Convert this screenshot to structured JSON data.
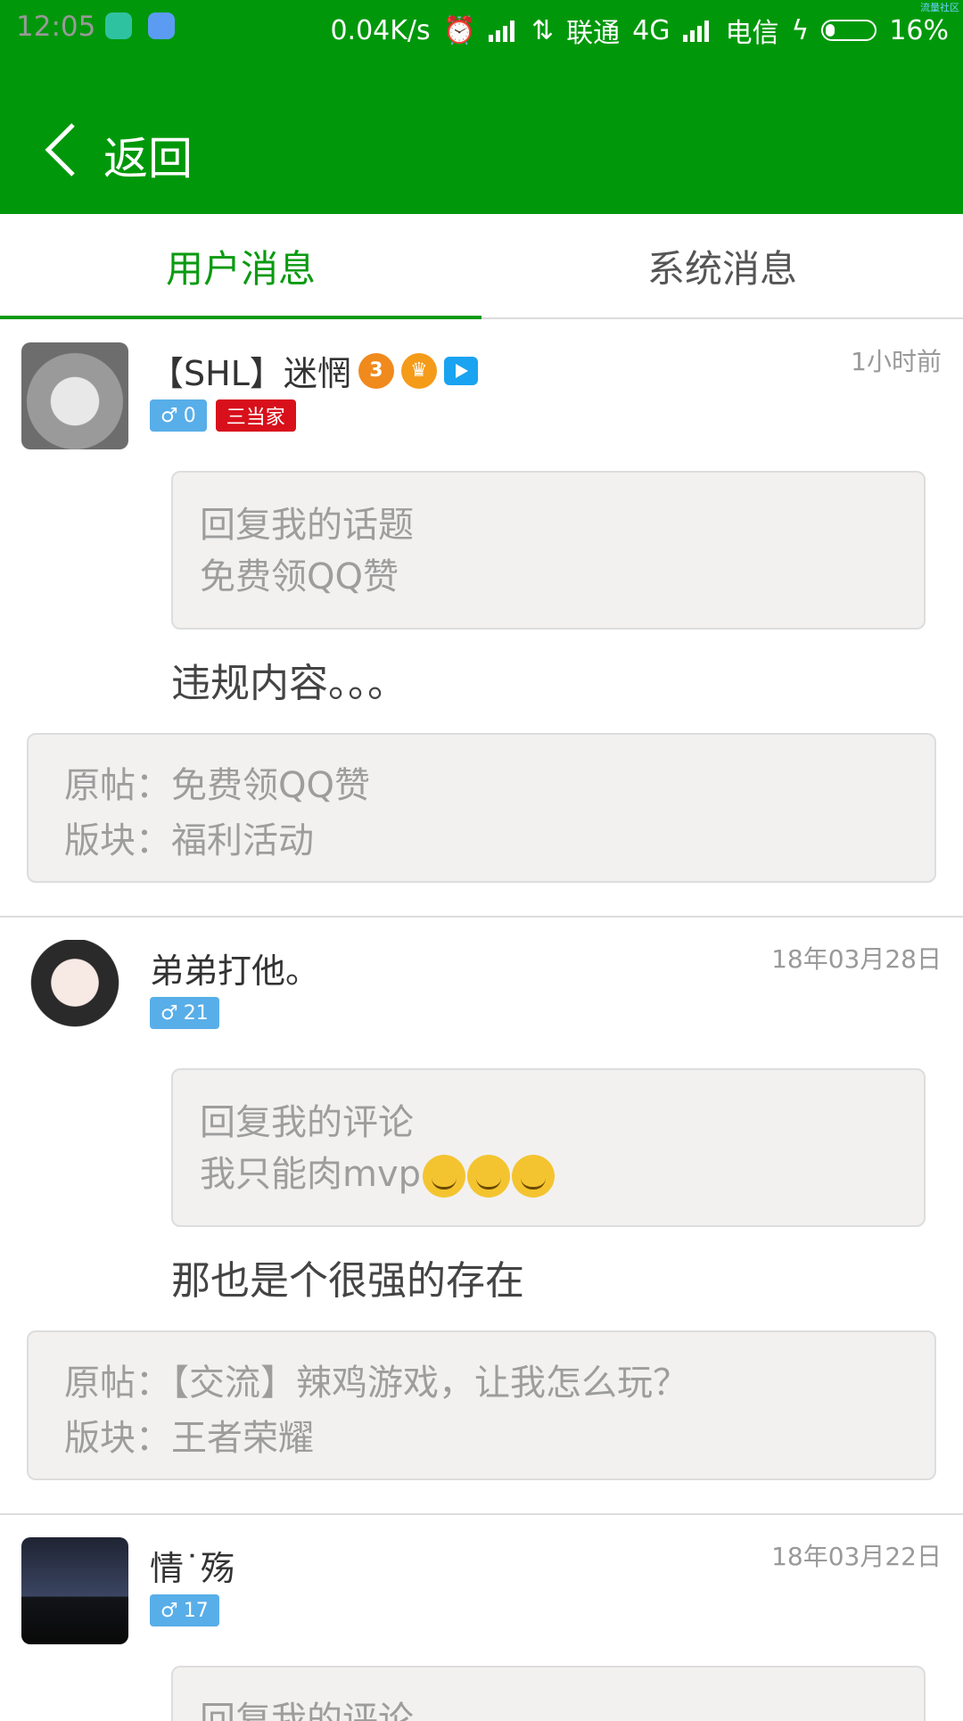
{
  "status_bar": {
    "time": "12:05",
    "net_speed": "0.04K/s",
    "carrier1": "联通",
    "network_type": "4G",
    "carrier2": "电信",
    "battery": "16%",
    "corner_text": "流量社区"
  },
  "app_bar": {
    "back_label": "返回",
    "colors": {
      "bar": "#00980a",
      "accent": "#0a9a10"
    }
  },
  "tabs": {
    "user": "用户消息",
    "system": "系统消息",
    "selected": "user"
  },
  "messages": [
    {
      "name": "【SHL】迷惘",
      "level_medal": "3",
      "gender_symbol": "♂",
      "points": "0",
      "rank": "三当家",
      "time": "1小时前",
      "quote_line1": "回复我的话题",
      "quote_line2": "免费领QQ赞",
      "reply": "违规内容。。。",
      "origin_post": "原帖：免费领QQ赞",
      "origin_board": "版块：福利活动"
    },
    {
      "name": "弟弟打他。",
      "gender_symbol": "♂",
      "points": "21",
      "time": "18年03月28日",
      "quote_line1": "回复我的评论",
      "quote_line2": "我只能肉mvp",
      "reply": "那也是个很强的存在",
      "origin_post": "原帖：【交流】辣鸡游戏，让我怎么玩？",
      "origin_board": "版块：王者荣耀"
    },
    {
      "name": "情˙殇",
      "gender_symbol": "♂",
      "points": "17",
      "time": "18年03月22日",
      "quote_line1": "回复我的评论"
    }
  ]
}
